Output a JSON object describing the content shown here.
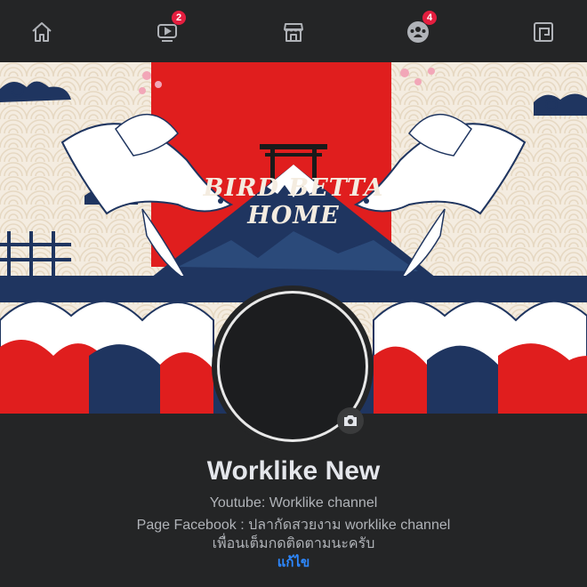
{
  "nav": {
    "items": [
      {
        "name": "home-icon",
        "badge": ""
      },
      {
        "name": "watch-icon",
        "badge": "2"
      },
      {
        "name": "marketplace-icon",
        "badge": ""
      },
      {
        "name": "groups-icon",
        "badge": "4"
      },
      {
        "name": "gaming-icon",
        "badge": ""
      }
    ]
  },
  "cover": {
    "title": "BIRD BETTA HOME",
    "colors": {
      "red": "#e01e1e",
      "navy": "#1f3560",
      "cream": "#f4ece0",
      "white": "#ffffff"
    }
  },
  "profile": {
    "name": "Worklike New",
    "bio": [
      "Youtube: Worklike channel",
      "Page Facebook : ปลากัดสวยงาม worklike channel",
      "เพื่อนเต็มกดติดตามนะครับ"
    ],
    "edit_label": "แก้ไข"
  },
  "colors": {
    "background": "#242526",
    "link": "#2d88ff",
    "badge": "#e41e3f",
    "text": "#e4e6eb"
  }
}
